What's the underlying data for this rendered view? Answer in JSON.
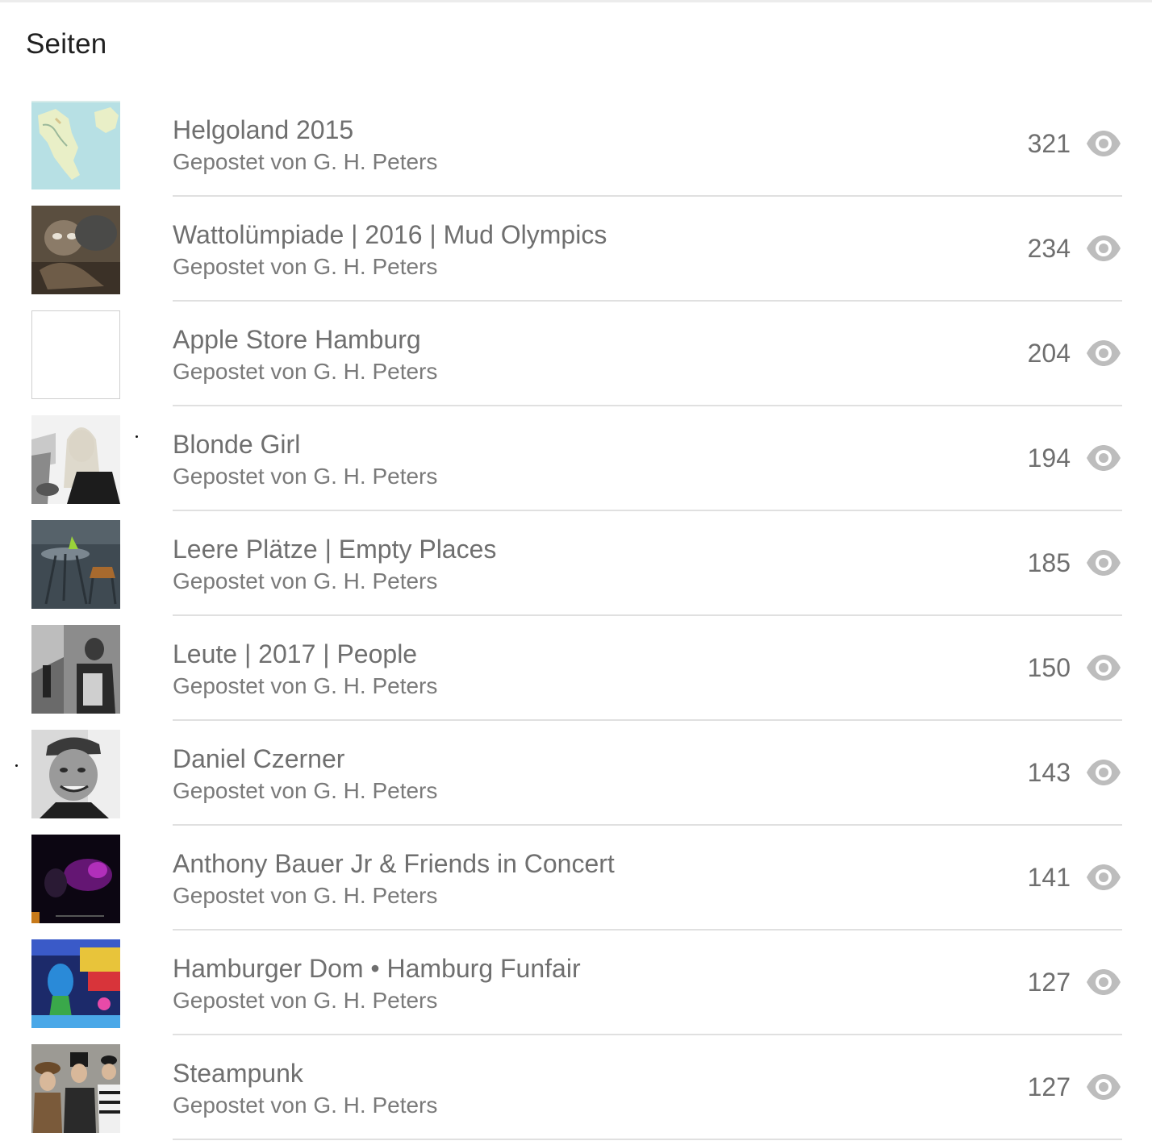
{
  "section": {
    "title": "Seiten"
  },
  "colors": {
    "text_primary": "#6f6f6f",
    "divider": "#e0e0e0",
    "icon": "#bdbdbd"
  },
  "items": [
    {
      "title": "Helgoland 2015",
      "author": "Gepostet von G. H. Peters",
      "views": "321",
      "icon": "eye-icon"
    },
    {
      "title": "Wattolümpiade | 2016 | Mud Olympics",
      "author": "Gepostet von G. H. Peters",
      "views": "234",
      "icon": "eye-icon"
    },
    {
      "title": "Apple Store Hamburg",
      "author": "Gepostet von G. H. Peters",
      "views": "204",
      "icon": "eye-icon"
    },
    {
      "title": "Blonde Girl",
      "author": "Gepostet von G. H. Peters",
      "views": "194",
      "icon": "eye-icon"
    },
    {
      "title": "Leere Plätze | Empty Places",
      "author": "Gepostet von G. H. Peters",
      "views": "185",
      "icon": "eye-icon"
    },
    {
      "title": "Leute | 2017 | People",
      "author": "Gepostet von G. H. Peters",
      "views": "150",
      "icon": "eye-icon"
    },
    {
      "title": "Daniel Czerner",
      "author": "Gepostet von G. H. Peters",
      "views": "143",
      "icon": "eye-icon"
    },
    {
      "title": "Anthony Bauer Jr & Friends in Concert",
      "author": "Gepostet von G. H. Peters",
      "views": "141",
      "icon": "eye-icon"
    },
    {
      "title": "Hamburger Dom • Hamburg Funfair",
      "author": "Gepostet von G. H. Peters",
      "views": "127",
      "icon": "eye-icon"
    },
    {
      "title": "Steampunk",
      "author": "Gepostet von G. H. Peters",
      "views": "127",
      "icon": "eye-icon"
    }
  ]
}
